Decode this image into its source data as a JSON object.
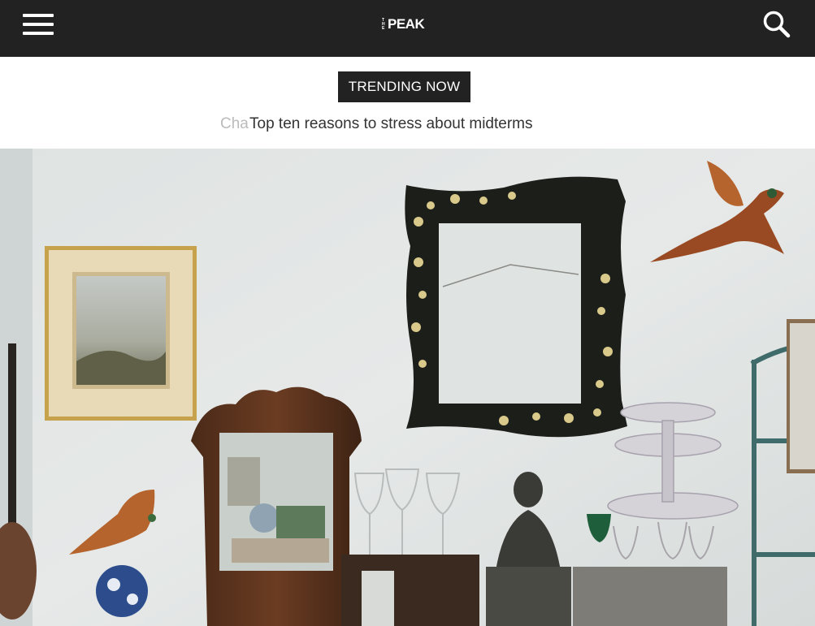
{
  "header": {
    "menu_icon": "hamburger-menu-icon",
    "logo_small": "THE",
    "logo_word": "PEAK",
    "search_icon": "search-icon",
    "bar_color": "#222222"
  },
  "trending": {
    "badge_label": "TRENDING NOW",
    "previous_partial": "Cha",
    "current_headline": "Top ten reasons to stress about midterms"
  },
  "hero": {
    "image_kind": "photo-still-life-wall"
  }
}
